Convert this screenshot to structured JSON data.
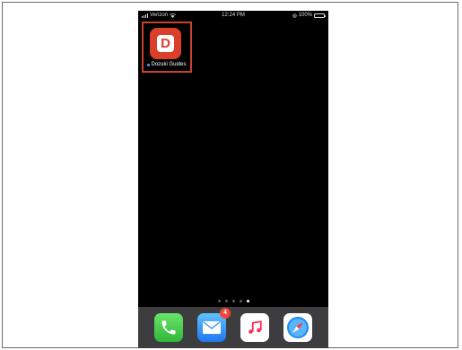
{
  "status_bar": {
    "carrier": "Verizon",
    "time": "12:24 PM",
    "battery_percent": "100%"
  },
  "home_screen": {
    "apps": [
      {
        "label": "Dozuki Guides",
        "icon_letter": "D",
        "icon": "dozuki-app-icon",
        "color": "#d93f2b",
        "new_install_dot": true
      }
    ],
    "page_count": 5,
    "active_page": 5
  },
  "highlight": {
    "color": "#c8432b"
  },
  "dock": {
    "apps": [
      {
        "name": "Phone",
        "icon": "phone-icon"
      },
      {
        "name": "Mail",
        "icon": "mail-icon",
        "badge": "4"
      },
      {
        "name": "Music",
        "icon": "music-note-icon"
      },
      {
        "name": "Safari",
        "icon": "compass-icon"
      }
    ]
  }
}
